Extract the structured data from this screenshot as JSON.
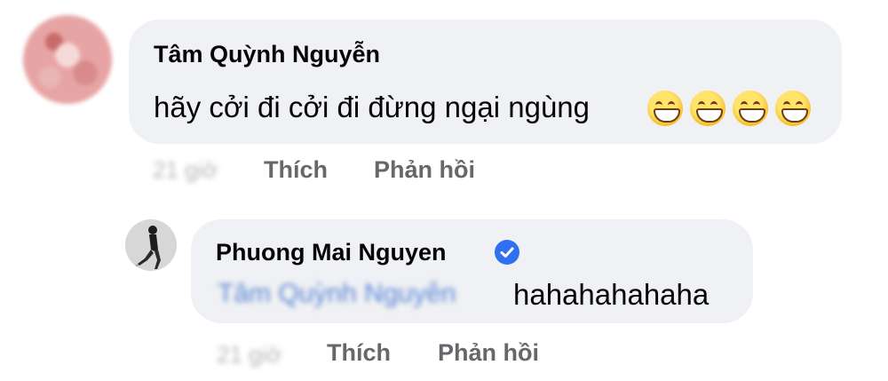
{
  "comments": [
    {
      "author": "Tâm Quỳnh Nguyễn",
      "text": "hãy cởi đi cởi đi đừng ngại ngùng",
      "emojis": [
        "grinning-face",
        "grinning-face",
        "grinning-face",
        "grinning-face"
      ],
      "time": "21 giờ",
      "like_label": "Thích",
      "reply_label": "Phản hồi"
    }
  ],
  "reply": {
    "author": "Phuong Mai Nguyen",
    "verified": true,
    "mention": "Tâm Quỳnh Nguyễn",
    "text": "hahahahahaha",
    "time": "21 giờ",
    "like_label": "Thích",
    "reply_label": "Phản hồi"
  },
  "colors": {
    "bubble": "#eff1f4",
    "text": "#050505",
    "action": "#65676b",
    "verified": "#2f6ff0",
    "mention": "#5a85d6"
  }
}
